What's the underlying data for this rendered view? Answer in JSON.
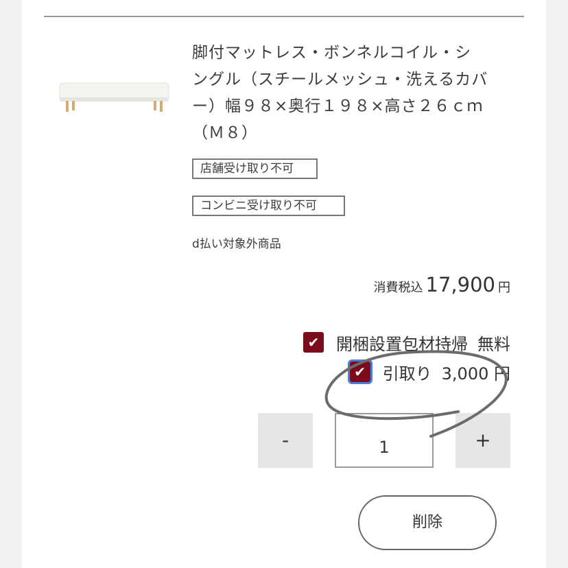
{
  "product": {
    "image_icon": "mattress-image",
    "title_lines": [
      "脚付マットレス・ボンネルコイル・シ",
      "ングル（スチールメッシュ・洗えるカバ",
      "ー）幅９８×奥行１９８×高さ２６ｃｍ",
      "（Ｍ８）"
    ],
    "tags": [
      "店舗受け取り不可",
      "コンビニ受け取り不可"
    ],
    "d_payment_note": "d払い対象外商品"
  },
  "price": {
    "label": "消費税込",
    "value": "17,900",
    "unit": "円"
  },
  "options": [
    {
      "label": "開梱設置包材持帰",
      "price": "無料",
      "checked": true
    },
    {
      "label": "引取り",
      "price": "3,000 円",
      "checked": true
    }
  ],
  "quantity": {
    "minus_label": "-",
    "value": "1",
    "plus_label": "+"
  },
  "delete_label": "削除",
  "colors": {
    "checkbox": "#7c0c1b",
    "focus_ring": "#4a7fe0",
    "annotation": "#6b6b6b"
  }
}
